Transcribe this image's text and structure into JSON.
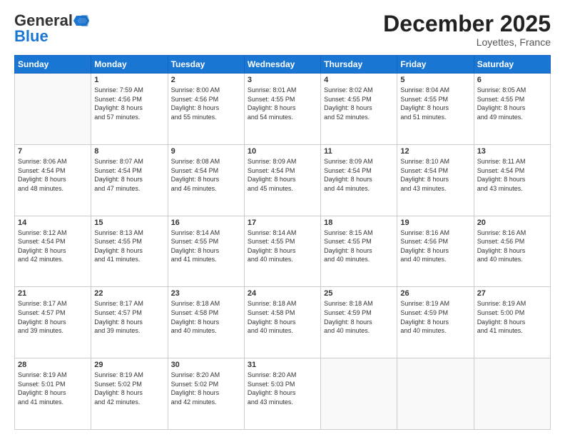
{
  "header": {
    "logo_line1": "General",
    "logo_line2": "Blue",
    "month_title": "December 2025",
    "location": "Loyettes, France"
  },
  "weekdays": [
    "Sunday",
    "Monday",
    "Tuesday",
    "Wednesday",
    "Thursday",
    "Friday",
    "Saturday"
  ],
  "weeks": [
    [
      {
        "day": "",
        "info": ""
      },
      {
        "day": "1",
        "info": "Sunrise: 7:59 AM\nSunset: 4:56 PM\nDaylight: 8 hours\nand 57 minutes."
      },
      {
        "day": "2",
        "info": "Sunrise: 8:00 AM\nSunset: 4:56 PM\nDaylight: 8 hours\nand 55 minutes."
      },
      {
        "day": "3",
        "info": "Sunrise: 8:01 AM\nSunset: 4:55 PM\nDaylight: 8 hours\nand 54 minutes."
      },
      {
        "day": "4",
        "info": "Sunrise: 8:02 AM\nSunset: 4:55 PM\nDaylight: 8 hours\nand 52 minutes."
      },
      {
        "day": "5",
        "info": "Sunrise: 8:04 AM\nSunset: 4:55 PM\nDaylight: 8 hours\nand 51 minutes."
      },
      {
        "day": "6",
        "info": "Sunrise: 8:05 AM\nSunset: 4:55 PM\nDaylight: 8 hours\nand 49 minutes."
      }
    ],
    [
      {
        "day": "7",
        "info": "Sunrise: 8:06 AM\nSunset: 4:54 PM\nDaylight: 8 hours\nand 48 minutes."
      },
      {
        "day": "8",
        "info": "Sunrise: 8:07 AM\nSunset: 4:54 PM\nDaylight: 8 hours\nand 47 minutes."
      },
      {
        "day": "9",
        "info": "Sunrise: 8:08 AM\nSunset: 4:54 PM\nDaylight: 8 hours\nand 46 minutes."
      },
      {
        "day": "10",
        "info": "Sunrise: 8:09 AM\nSunset: 4:54 PM\nDaylight: 8 hours\nand 45 minutes."
      },
      {
        "day": "11",
        "info": "Sunrise: 8:09 AM\nSunset: 4:54 PM\nDaylight: 8 hours\nand 44 minutes."
      },
      {
        "day": "12",
        "info": "Sunrise: 8:10 AM\nSunset: 4:54 PM\nDaylight: 8 hours\nand 43 minutes."
      },
      {
        "day": "13",
        "info": "Sunrise: 8:11 AM\nSunset: 4:54 PM\nDaylight: 8 hours\nand 43 minutes."
      }
    ],
    [
      {
        "day": "14",
        "info": "Sunrise: 8:12 AM\nSunset: 4:54 PM\nDaylight: 8 hours\nand 42 minutes."
      },
      {
        "day": "15",
        "info": "Sunrise: 8:13 AM\nSunset: 4:55 PM\nDaylight: 8 hours\nand 41 minutes."
      },
      {
        "day": "16",
        "info": "Sunrise: 8:14 AM\nSunset: 4:55 PM\nDaylight: 8 hours\nand 41 minutes."
      },
      {
        "day": "17",
        "info": "Sunrise: 8:14 AM\nSunset: 4:55 PM\nDaylight: 8 hours\nand 40 minutes."
      },
      {
        "day": "18",
        "info": "Sunrise: 8:15 AM\nSunset: 4:55 PM\nDaylight: 8 hours\nand 40 minutes."
      },
      {
        "day": "19",
        "info": "Sunrise: 8:16 AM\nSunset: 4:56 PM\nDaylight: 8 hours\nand 40 minutes."
      },
      {
        "day": "20",
        "info": "Sunrise: 8:16 AM\nSunset: 4:56 PM\nDaylight: 8 hours\nand 40 minutes."
      }
    ],
    [
      {
        "day": "21",
        "info": "Sunrise: 8:17 AM\nSunset: 4:57 PM\nDaylight: 8 hours\nand 39 minutes."
      },
      {
        "day": "22",
        "info": "Sunrise: 8:17 AM\nSunset: 4:57 PM\nDaylight: 8 hours\nand 39 minutes."
      },
      {
        "day": "23",
        "info": "Sunrise: 8:18 AM\nSunset: 4:58 PM\nDaylight: 8 hours\nand 40 minutes."
      },
      {
        "day": "24",
        "info": "Sunrise: 8:18 AM\nSunset: 4:58 PM\nDaylight: 8 hours\nand 40 minutes."
      },
      {
        "day": "25",
        "info": "Sunrise: 8:18 AM\nSunset: 4:59 PM\nDaylight: 8 hours\nand 40 minutes."
      },
      {
        "day": "26",
        "info": "Sunrise: 8:19 AM\nSunset: 4:59 PM\nDaylight: 8 hours\nand 40 minutes."
      },
      {
        "day": "27",
        "info": "Sunrise: 8:19 AM\nSunset: 5:00 PM\nDaylight: 8 hours\nand 41 minutes."
      }
    ],
    [
      {
        "day": "28",
        "info": "Sunrise: 8:19 AM\nSunset: 5:01 PM\nDaylight: 8 hours\nand 41 minutes."
      },
      {
        "day": "29",
        "info": "Sunrise: 8:19 AM\nSunset: 5:02 PM\nDaylight: 8 hours\nand 42 minutes."
      },
      {
        "day": "30",
        "info": "Sunrise: 8:20 AM\nSunset: 5:02 PM\nDaylight: 8 hours\nand 42 minutes."
      },
      {
        "day": "31",
        "info": "Sunrise: 8:20 AM\nSunset: 5:03 PM\nDaylight: 8 hours\nand 43 minutes."
      },
      {
        "day": "",
        "info": ""
      },
      {
        "day": "",
        "info": ""
      },
      {
        "day": "",
        "info": ""
      }
    ]
  ]
}
